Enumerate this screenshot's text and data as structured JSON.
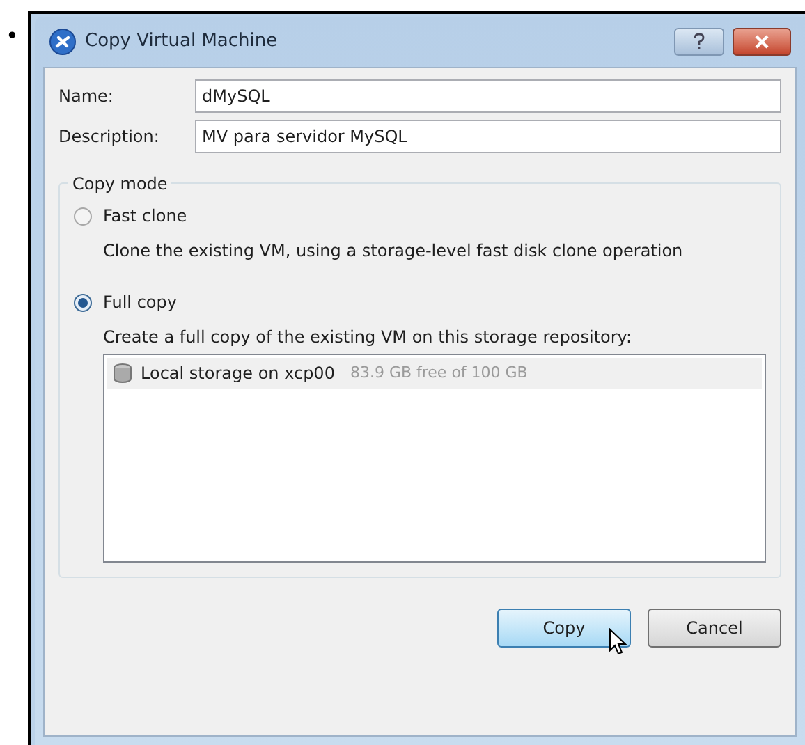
{
  "bullet": "•",
  "window": {
    "title": "Copy Virtual Machine"
  },
  "fields": [
    {
      "label": "Name:",
      "value": "dMySQL"
    },
    {
      "label": "Description:",
      "value": "MV para servidor MySQL"
    }
  ],
  "copy_mode": {
    "title": "Copy mode",
    "options": [
      {
        "label": "Fast clone",
        "selected": false,
        "description": "Clone the existing VM, using a storage-level fast disk clone operation"
      },
      {
        "label": "Full copy",
        "selected": true,
        "description": "Create a full copy of the existing VM on this storage repository:"
      }
    ]
  },
  "storage_list": [
    {
      "name": "Local storage on xcp00",
      "detail": "83.9 GB free of 100 GB",
      "selected": true
    }
  ],
  "buttons": [
    {
      "label": "Copy",
      "kind": "default"
    },
    {
      "label": "Cancel",
      "kind": "normal"
    }
  ]
}
